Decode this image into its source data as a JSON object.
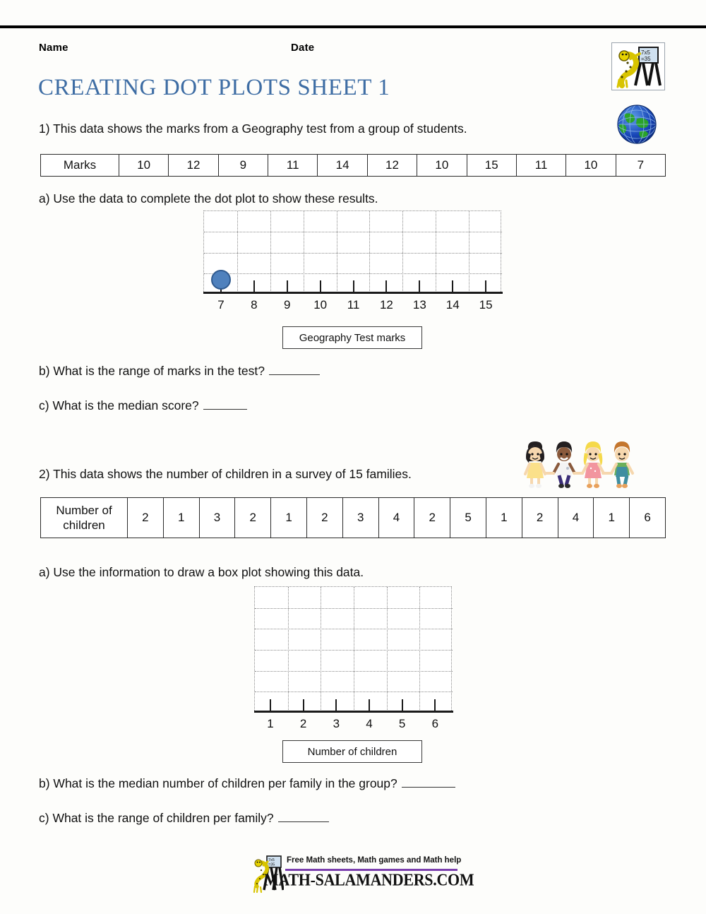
{
  "header": {
    "name_label": "Name",
    "date_label": "Date",
    "title": "CREATING DOT PLOTS SHEET 1",
    "title_color": "#3E6DA4",
    "logo_board_text_line1": "7x5",
    "logo_board_text_line2": "=35"
  },
  "question1": {
    "intro": "1) This data shows the marks from a Geography test from a group of students.",
    "table": {
      "row_label": "Marks",
      "values": [
        "10",
        "12",
        "9",
        "11",
        "14",
        "12",
        "10",
        "15",
        "11",
        "10",
        "7"
      ]
    },
    "part_a": "a) Use the data to complete the dot plot to show these results.",
    "part_b": "b) What is the range of marks in the test?",
    "part_c": "c) What is the median score?",
    "axis_label": "Geography Test marks"
  },
  "question2": {
    "intro": "2) This data shows the number of children in a survey of 15 families.",
    "table": {
      "row_label_line1": "Number of",
      "row_label_line2": "children",
      "values": [
        "2",
        "1",
        "3",
        "2",
        "1",
        "2",
        "3",
        "4",
        "2",
        "5",
        "1",
        "2",
        "4",
        "1",
        "6"
      ]
    },
    "part_a": "a) Use the information to draw a box plot showing this data.",
    "part_b": "b) What is the median number of children per family in the group?",
    "part_c": "c) What is the range of children per family?",
    "axis_label": "Number of children"
  },
  "chart_data": [
    {
      "type": "dotplot",
      "title": "",
      "xlabel": "Geography Test marks",
      "ylabel": "",
      "categories": [
        "7",
        "8",
        "9",
        "10",
        "11",
        "12",
        "13",
        "14",
        "15"
      ],
      "values": [
        1,
        0,
        0,
        0,
        0,
        0,
        0,
        0,
        0
      ],
      "plotted_points": [
        {
          "x": "7",
          "count": 1
        }
      ],
      "grid": true,
      "grid_rows": 4,
      "grid_cols": 9,
      "dot_color": "#4F81BD",
      "dot_border_color": "#2F5A8F",
      "note": "Only one dot is pre-plotted at x=7; students complete the rest."
    },
    {
      "type": "dotplot",
      "title": "",
      "xlabel": "Number of children",
      "ylabel": "",
      "categories": [
        "1",
        "2",
        "3",
        "4",
        "5",
        "6"
      ],
      "values": [
        0,
        0,
        0,
        0,
        0,
        0
      ],
      "plotted_points": [],
      "grid": true,
      "grid_rows": 6,
      "grid_cols": 6,
      "note": "Empty grid for students to draw the plot."
    }
  ],
  "footer": {
    "tagline": "Free Math sheets, Math games and Math help",
    "url": "MATH-SALAMANDERS.COM",
    "rule_color": "#7B3FAE"
  }
}
